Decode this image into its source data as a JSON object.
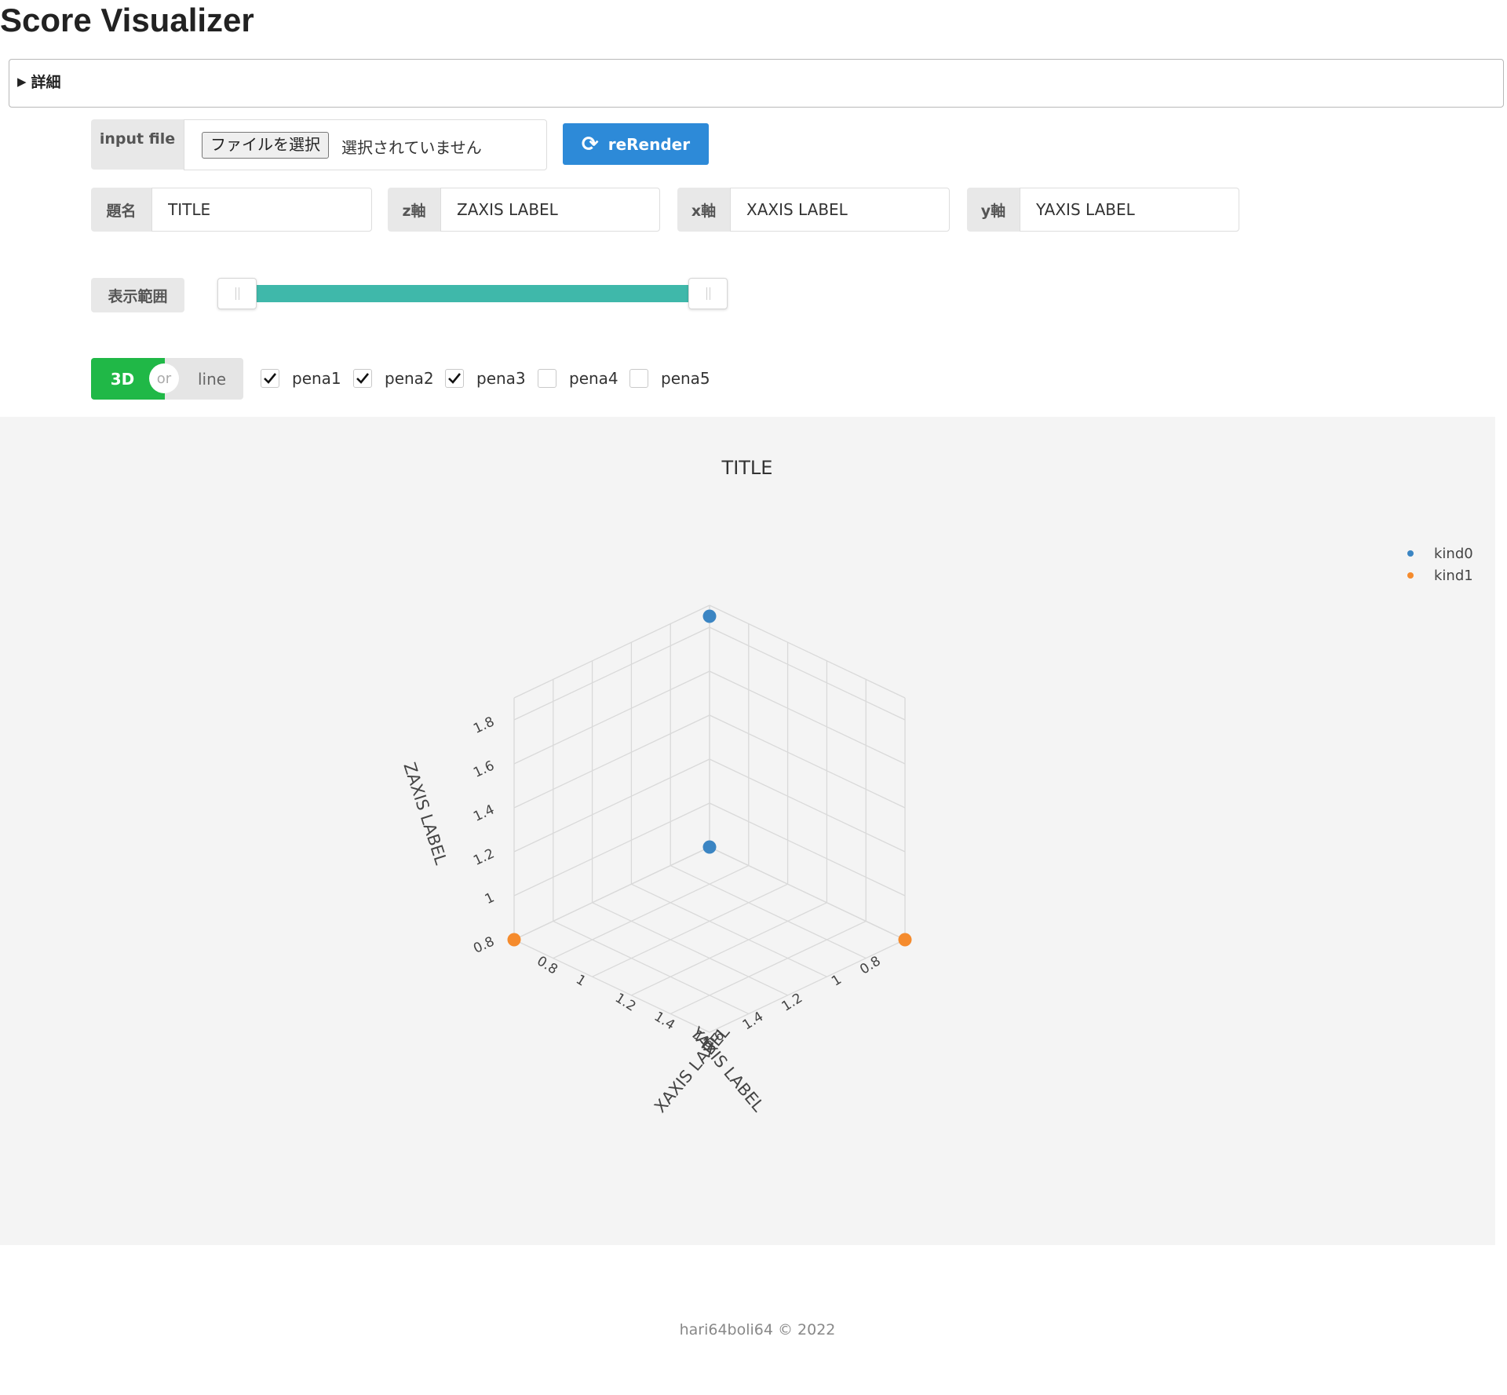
{
  "app": {
    "title": "Score Visualizer"
  },
  "details": {
    "summary": "詳細"
  },
  "file": {
    "label": "input file",
    "button_label": "ファイルを選択",
    "status": "選択されていません"
  },
  "rerender": {
    "label": "reRender",
    "icon": "refresh-icon"
  },
  "fields": {
    "title": {
      "label": "題名",
      "value": "TITLE"
    },
    "z": {
      "label": "z軸",
      "value": "ZAXIS LABEL"
    },
    "x": {
      "label": "x軸",
      "value": "XAXIS LABEL"
    },
    "y": {
      "label": "y軸",
      "value": "YAXIS LABEL"
    }
  },
  "range": {
    "label": "表示範囲",
    "min_fraction": 0.0,
    "max_fraction": 1.0
  },
  "mode_toggle": {
    "on_label": "3D",
    "or_label": "or",
    "off_label": "line",
    "selected": "3D"
  },
  "penalties": [
    {
      "label": "pena1",
      "checked": true
    },
    {
      "label": "pena2",
      "checked": true
    },
    {
      "label": "pena3",
      "checked": true
    },
    {
      "label": "pena4",
      "checked": false
    },
    {
      "label": "pena5",
      "checked": false
    }
  ],
  "chart_data": {
    "type": "scatter",
    "title": "TITLE",
    "xlabel": "XAXIS LABEL",
    "ylabel": "YAXIS LABEL",
    "zlabel": "ZAXIS LABEL",
    "xlim": [
      0.8,
      1.8
    ],
    "ylim": [
      0.8,
      1.8
    ],
    "zlim": [
      0.8,
      1.9
    ],
    "x_ticks": [
      "0.8",
      "1",
      "1.2",
      "1.4",
      "1.6"
    ],
    "y_ticks": [
      "0.8",
      "1",
      "1.2",
      "1.4",
      "1.6"
    ],
    "z_ticks": [
      "0.8",
      "1",
      "1.2",
      "1.4",
      "1.6",
      "1.8"
    ],
    "grid": true,
    "legend_position": "top-right",
    "series": [
      {
        "name": "kind0",
        "color": "#3b85c3",
        "points": [
          {
            "x": 0.8,
            "y": 0.8,
            "z": 1.85
          },
          {
            "x": 0.8,
            "y": 0.8,
            "z": 0.8
          }
        ]
      },
      {
        "name": "kind1",
        "color": "#f58b2d",
        "points": [
          {
            "x": 0.8,
            "y": 1.8,
            "z": 0.8
          },
          {
            "x": 1.8,
            "y": 0.8,
            "z": 0.8
          }
        ]
      }
    ]
  },
  "footer": {
    "text": "hari64boli64 © 2022"
  }
}
